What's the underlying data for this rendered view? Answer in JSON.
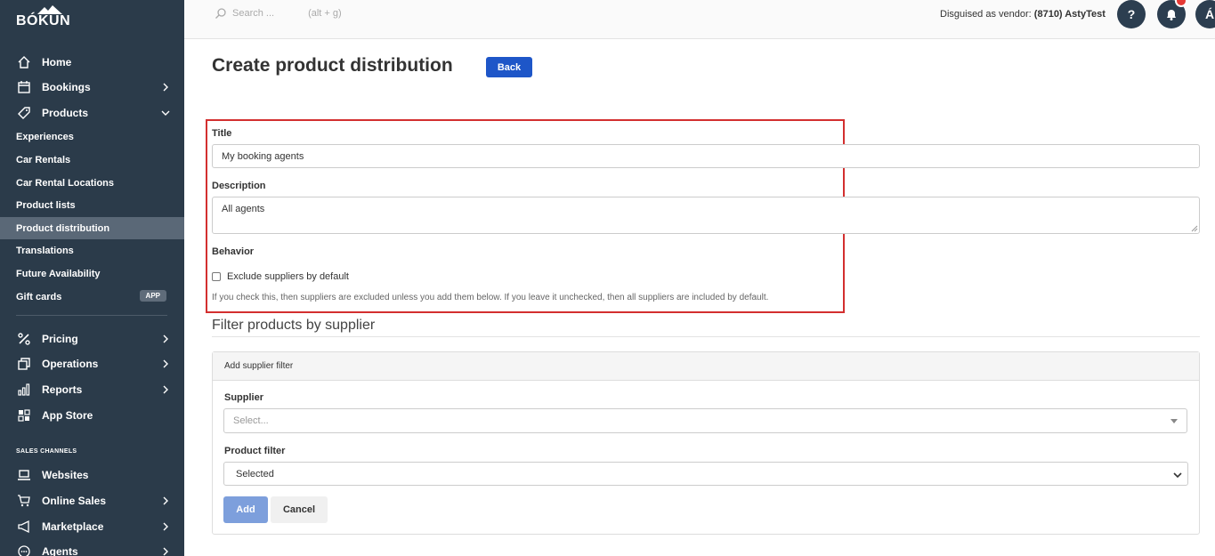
{
  "brand": {
    "logo_text": "BÓKUN"
  },
  "sidebar": {
    "main": [
      {
        "label": "Home",
        "icon": "home-icon"
      },
      {
        "label": "Bookings",
        "icon": "calendar-icon"
      },
      {
        "label": "Products",
        "icon": "tag-icon"
      }
    ],
    "products_sub": [
      {
        "label": "Experiences"
      },
      {
        "label": "Car Rentals"
      },
      {
        "label": "Car Rental Locations"
      },
      {
        "label": "Product lists"
      },
      {
        "label": "Product distribution",
        "active": true
      },
      {
        "label": "Translations"
      },
      {
        "label": "Future Availability"
      },
      {
        "label": "Gift cards",
        "badge": "APP"
      }
    ],
    "tools": [
      {
        "label": "Pricing",
        "icon": "percent-icon"
      },
      {
        "label": "Operations",
        "icon": "copy-icon"
      },
      {
        "label": "Reports",
        "icon": "bar-chart-icon"
      },
      {
        "label": "App Store",
        "icon": "apps-grid-icon"
      }
    ],
    "sales_channels_label": "SALES CHANNELS",
    "channels": [
      {
        "label": "Websites",
        "icon": "laptop-icon"
      },
      {
        "label": "Online Sales",
        "icon": "cart-icon"
      },
      {
        "label": "Marketplace",
        "icon": "megaphone-icon"
      },
      {
        "label": "Agents",
        "icon": "agents-icon"
      }
    ]
  },
  "topbar": {
    "search_placeholder": "Search ...",
    "search_hint": "(alt + g)",
    "disguised_prefix": "Disguised as vendor:",
    "disguised_vendor": "(8710) AstyTest",
    "help_label": "?",
    "avatar_initial": "Á"
  },
  "page": {
    "title": "Create product distribution",
    "back_label": "Back"
  },
  "form": {
    "title_label": "Title",
    "title_value": "My booking agents",
    "description_label": "Description",
    "description_value": "All agents",
    "behavior_label": "Behavior",
    "exclude_label": "Exclude suppliers by default",
    "exclude_checked": false,
    "help_text": "If you check this, then suppliers are excluded unless you add them below. If you leave it unchecked, then all suppliers are included by default."
  },
  "filter": {
    "section_title": "Filter products by supplier",
    "panel_title": "Add supplier filter",
    "supplier_label": "Supplier",
    "supplier_placeholder": "Select...",
    "product_filter_label": "Product filter",
    "product_filter_value": "Selected",
    "add_label": "Add",
    "cancel_label": "Cancel"
  }
}
